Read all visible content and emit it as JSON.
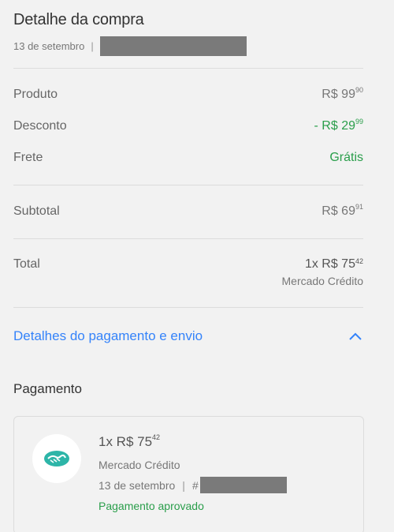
{
  "header": {
    "title": "Detalhe da compra",
    "date": "13 de setembro",
    "separator": "|"
  },
  "summary": {
    "produto_label": "Produto",
    "produto_main": "R$ 99",
    "produto_cents": "90",
    "desconto_label": "Desconto",
    "desconto_main": "- R$ 29",
    "desconto_cents": "99",
    "frete_label": "Frete",
    "frete_value": "Grátis",
    "subtotal_label": "Subtotal",
    "subtotal_main": "R$ 69",
    "subtotal_cents": "91",
    "total_label": "Total",
    "total_main": "1x R$ 75",
    "total_cents": "42",
    "total_method": "Mercado Crédito"
  },
  "details_link": {
    "label": "Detalhes do pagamento e envio",
    "icon": "chevron-up-icon"
  },
  "payment": {
    "section_title": "Pagamento",
    "amount_main": "1x R$ 75",
    "amount_cents": "42",
    "method": "Mercado Crédito",
    "date": "13 de setembro",
    "separator": "|",
    "hash": "#",
    "status": "Pagamento aprovado",
    "logo_icon": "mercado-pago-handshake-icon"
  },
  "colors": {
    "green": "#2a9e4b",
    "link_blue": "#3483fa",
    "background": "#f2f2f2",
    "logo_teal": "#2db5a8"
  }
}
